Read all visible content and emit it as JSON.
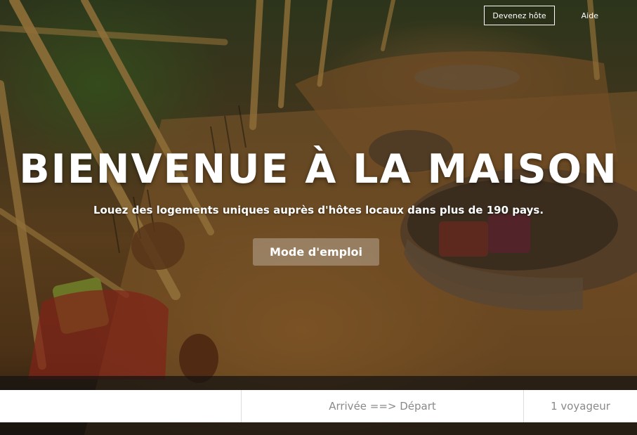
{
  "nav": {
    "become_host": "Devenez hôte",
    "help": "Aide"
  },
  "hero": {
    "title": "BIENVENUE À LA MAISON",
    "subtitle": "Louez des logements uniques auprès d'hôtes locaux dans plus de 190 pays.",
    "howto_button": "Mode d'emploi"
  },
  "search": {
    "where_value": "",
    "dates_label": "Arrivée ==> Départ",
    "guests_label": "1 voyageur"
  }
}
